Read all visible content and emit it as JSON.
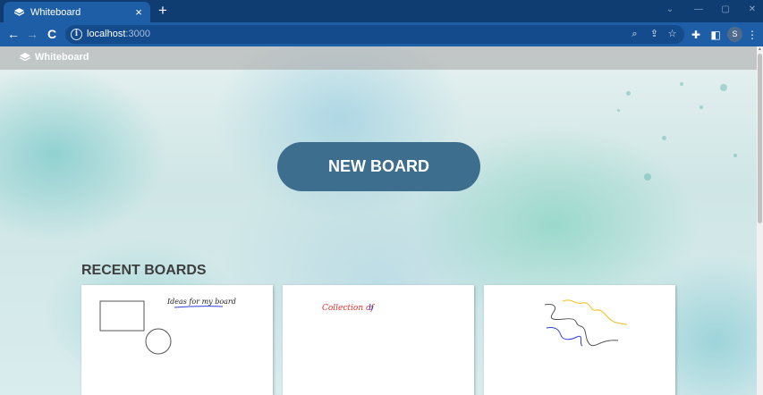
{
  "browser": {
    "tab_title": "Whiteboard",
    "tab_close": "×",
    "new_tab": "+",
    "nav": {
      "back": "←",
      "forward": "→",
      "reload": "C"
    },
    "url_host": "localhost",
    "url_port": ":3000",
    "profile_initial": "S"
  },
  "app": {
    "brand": "Whiteboard",
    "new_board_label": "NEW BOARD",
    "recent_heading": "RECENT BOARDS"
  },
  "boards": [
    {
      "preview_text": "Ideas for my board",
      "preview_kind": "shapes"
    },
    {
      "preview_text_red": "Collection of",
      "preview_text_blue": "b",
      "preview_kind": "text"
    },
    {
      "preview_kind": "squiggles"
    }
  ],
  "colors": {
    "tabstrip": "#0f3d72",
    "toolbar": "#1d5ea6",
    "new_board_button": "#3e6e8e",
    "heading": "#3e3e3e",
    "ink_red": "#e8302a",
    "ink_blue": "#2f3fd6",
    "ink_yellow": "#f0c020"
  }
}
